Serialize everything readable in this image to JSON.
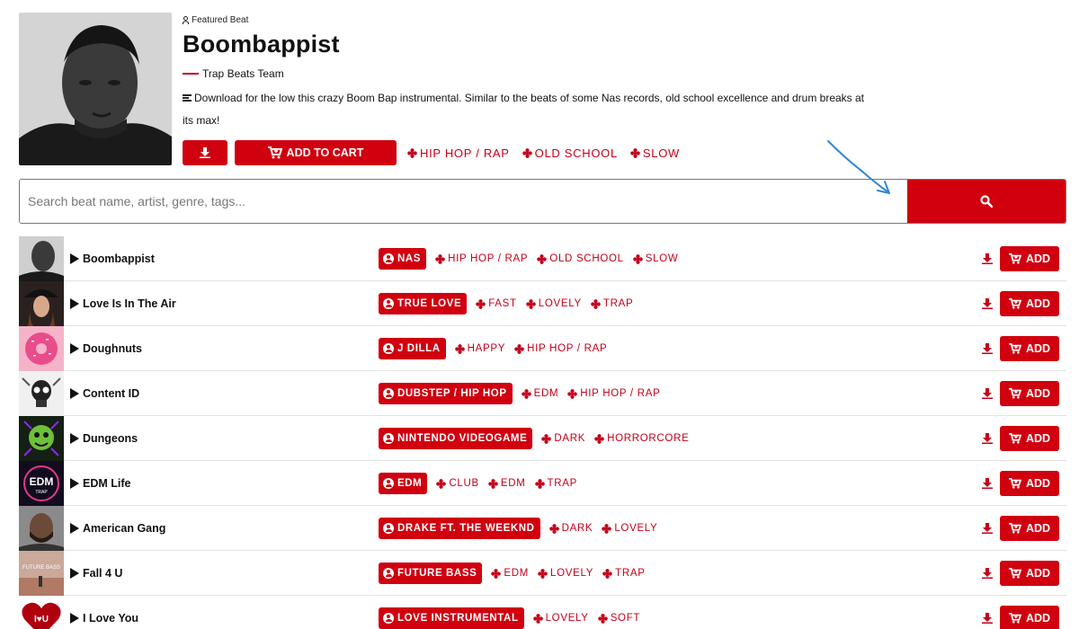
{
  "featured": {
    "kicker": "Featured Beat",
    "title": "Boombappist",
    "producer": "Trap Beats Team",
    "description": "Download for the low this crazy Boom Bap instrumental. Similar to the beats of some Nas records, old school excellence and drum breaks at its max!",
    "add_to_cart_label": "ADD TO CART",
    "tags": [
      "HIP HOP / RAP",
      "OLD SCHOOL",
      "SLOW"
    ]
  },
  "search": {
    "placeholder": "Search beat name, artist, genre, tags..."
  },
  "colors": {
    "accent": "#d0000f",
    "tag_text": "#c4001a",
    "annotation_arrow": "#2f86d6"
  },
  "beats": [
    {
      "title": "Boombappist",
      "artist": "NAS",
      "tags": [
        "HIP HOP / RAP",
        "OLD SCHOOL",
        "SLOW"
      ],
      "add_label": "ADD"
    },
    {
      "title": "Love Is In The Air",
      "artist": "TRUE LOVE",
      "tags": [
        "FAST",
        "LOVELY",
        "TRAP"
      ],
      "add_label": "ADD"
    },
    {
      "title": "Doughnuts",
      "artist": "J DILLA",
      "tags": [
        "HAPPY",
        "HIP HOP / RAP"
      ],
      "add_label": "ADD"
    },
    {
      "title": "Content ID",
      "artist": "DUBSTEP / HIP HOP",
      "tags": [
        "EDM",
        "HIP HOP / RAP"
      ],
      "add_label": "ADD"
    },
    {
      "title": "Dungeons",
      "artist": "NINTENDO VIDEOGAME",
      "tags": [
        "DARK",
        "HORRORCORE"
      ],
      "add_label": "ADD"
    },
    {
      "title": "EDM Life",
      "artist": "EDM",
      "tags": [
        "CLUB",
        "EDM",
        "TRAP"
      ],
      "add_label": "ADD"
    },
    {
      "title": "American Gang",
      "artist": "DRAKE FT. THE WEEKND",
      "tags": [
        "DARK",
        "LOVELY"
      ],
      "add_label": "ADD"
    },
    {
      "title": "Fall 4 U",
      "artist": "FUTURE BASS",
      "tags": [
        "EDM",
        "LOVELY",
        "TRAP"
      ],
      "add_label": "ADD"
    },
    {
      "title": "I Love You",
      "artist": "LOVE INSTRUMENTAL",
      "tags": [
        "LOVELY",
        "SOFT"
      ],
      "add_label": "ADD"
    }
  ],
  "thumb_text": {
    "edm_life": "EDM",
    "edm_life_sub": "TRAP",
    "fall_4_u": "FUTURE BASS",
    "i_love_you": "I♥U"
  }
}
